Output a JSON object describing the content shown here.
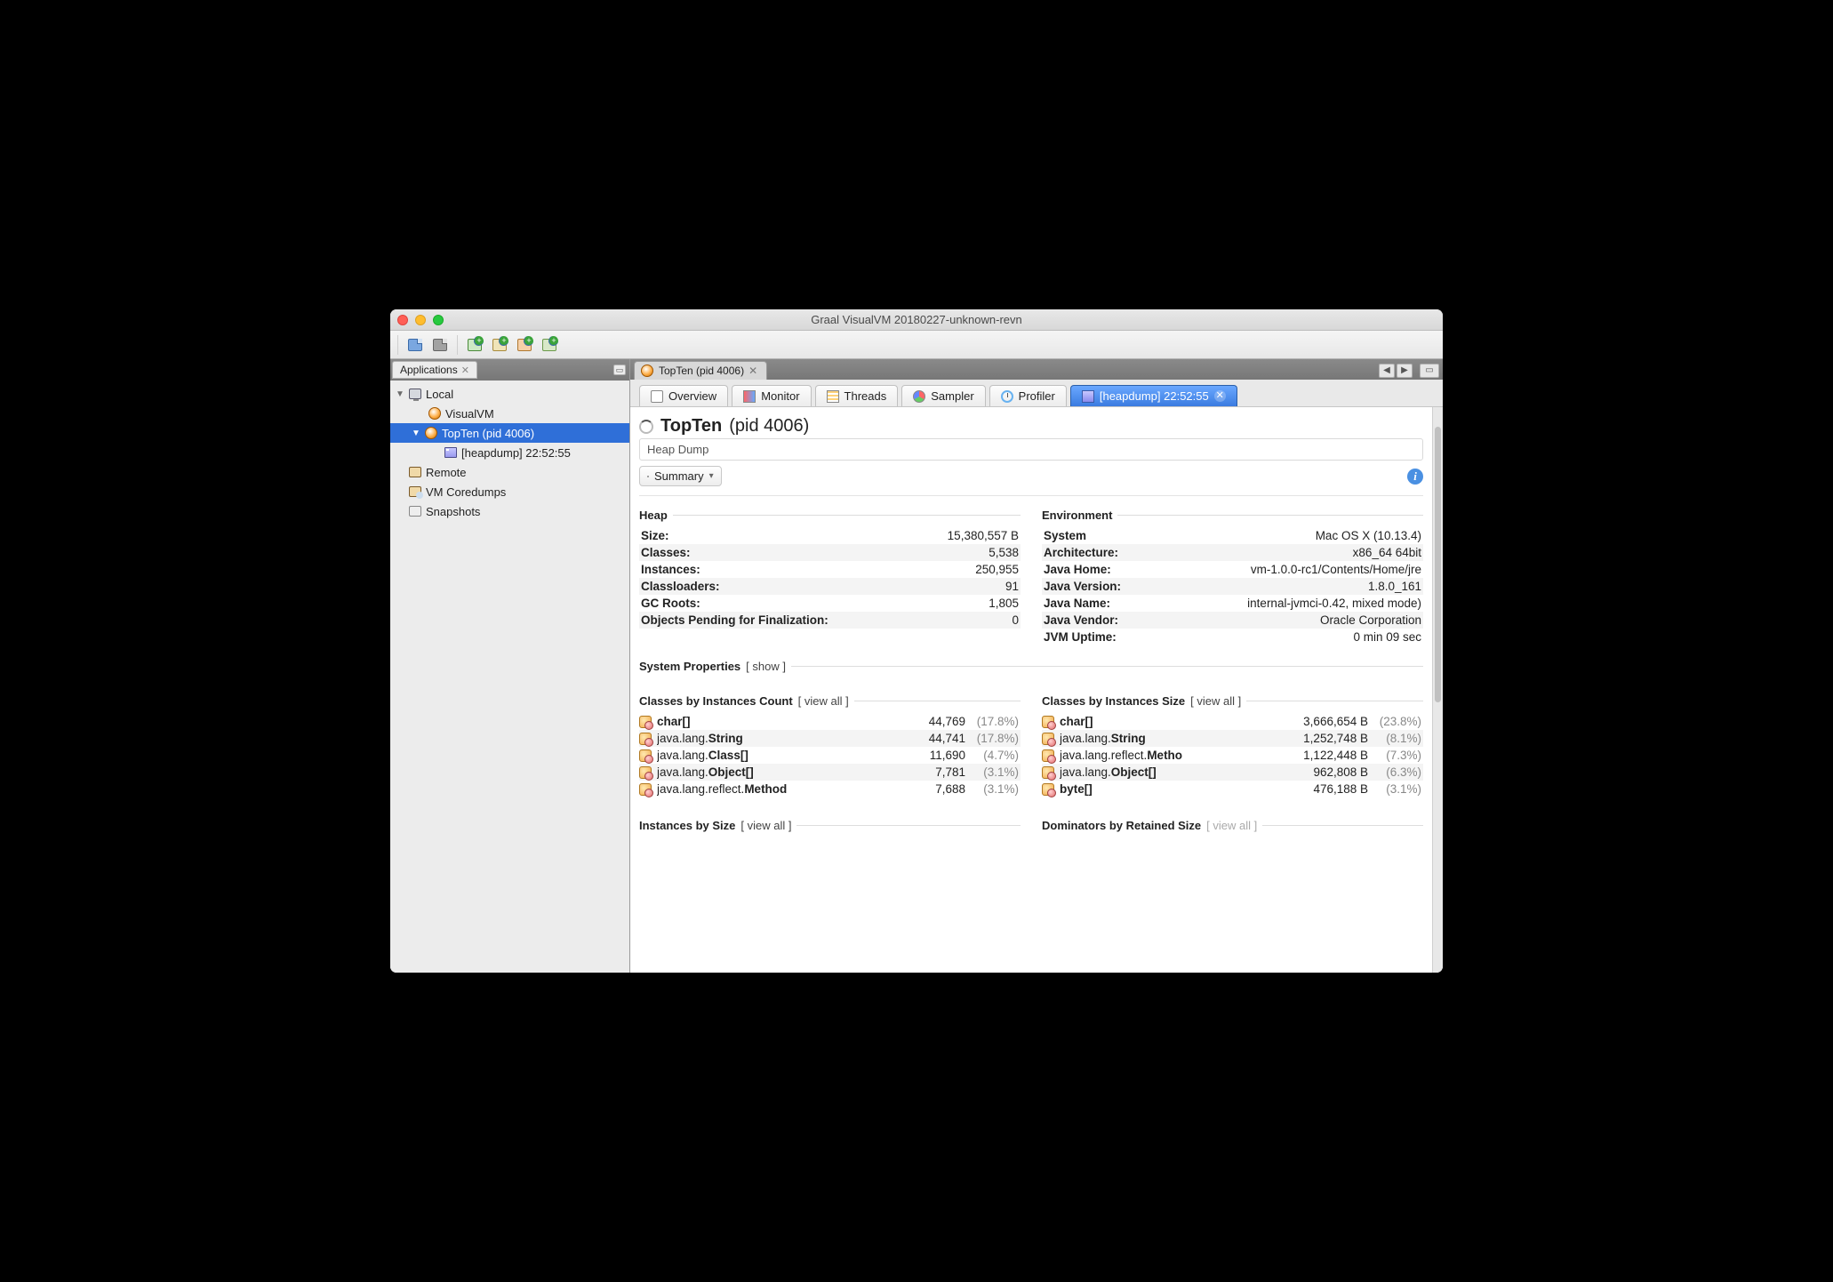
{
  "window_title": "Graal VisualVM 20180227-unknown-revn",
  "sidebar": {
    "panel_title": "Applications",
    "nodes": {
      "local": "Local",
      "visualvm": "VisualVM",
      "topten": "TopTen (pid 4006)",
      "heapdump": "[heapdump] 22:52:55",
      "remote": "Remote",
      "coredumps": "VM Coredumps",
      "snapshots": "Snapshots"
    }
  },
  "main_tab": "TopTen (pid 4006)",
  "subtabs": {
    "overview": "Overview",
    "monitor": "Monitor",
    "threads": "Threads",
    "sampler": "Sampler",
    "profiler": "Profiler",
    "heapdump": "[heapdump] 22:52:55"
  },
  "heading_bold": "TopTen",
  "heading_rest": "(pid 4006)",
  "subhead": "Heap Dump",
  "summary_label": "Summary",
  "sections": {
    "heap": "Heap",
    "env": "Environment",
    "sysprops": "System Properties",
    "show_link": "[ show ]",
    "cbic": "Classes by Instances Count",
    "cbis": "Classes by Instances Size",
    "viewall": "[ view all ]",
    "ibs": "Instances by Size",
    "dbrs": "Dominators by Retained Size"
  },
  "heap": [
    {
      "k": "Size:",
      "v": "15,380,557 B"
    },
    {
      "k": "Classes:",
      "v": "5,538"
    },
    {
      "k": "Instances:",
      "v": "250,955"
    },
    {
      "k": "Classloaders:",
      "v": "91"
    },
    {
      "k": "GC Roots:",
      "v": "1,805"
    },
    {
      "k": "Objects Pending for Finalization:",
      "v": "0"
    }
  ],
  "env": [
    {
      "k": "System",
      "v": "Mac OS X (10.13.4)"
    },
    {
      "k": "Architecture:",
      "v": "x86_64 64bit"
    },
    {
      "k": "Java Home:",
      "v": "vm-1.0.0-rc1/Contents/Home/jre"
    },
    {
      "k": "Java Version:",
      "v": "1.8.0_161"
    },
    {
      "k": "Java Name:",
      "v": "internal-jvmci-0.42, mixed mode)"
    },
    {
      "k": "Java Vendor:",
      "v": "Oracle Corporation"
    },
    {
      "k": "JVM Uptime:",
      "v": "0 min 09 sec"
    }
  ],
  "by_count": [
    {
      "pre": "",
      "em": "char[]",
      "n": "44,769",
      "p": "(17.8%)"
    },
    {
      "pre": "java.lang.",
      "em": "String",
      "n": "44,741",
      "p": "(17.8%)"
    },
    {
      "pre": "java.lang.",
      "em": "Class[]",
      "n": "11,690",
      "p": "(4.7%)"
    },
    {
      "pre": "java.lang.",
      "em": "Object[]",
      "n": "7,781",
      "p": "(3.1%)"
    },
    {
      "pre": "java.lang.reflect.",
      "em": "Method",
      "n": "7,688",
      "p": "(3.1%)"
    }
  ],
  "by_size": [
    {
      "pre": "",
      "em": "char[]",
      "n": "3,666,654 B",
      "p": "(23.8%)"
    },
    {
      "pre": "java.lang.",
      "em": "String",
      "n": "1,252,748 B",
      "p": "(8.1%)"
    },
    {
      "pre": "java.lang.reflect.",
      "em": "Metho",
      "n": "1,122,448 B",
      "p": "(7.3%)"
    },
    {
      "pre": "java.lang.",
      "em": "Object[]",
      "n": "962,808 B",
      "p": "(6.3%)"
    },
    {
      "pre": "",
      "em": "byte[]",
      "n": "476,188 B",
      "p": "(3.1%)"
    }
  ]
}
